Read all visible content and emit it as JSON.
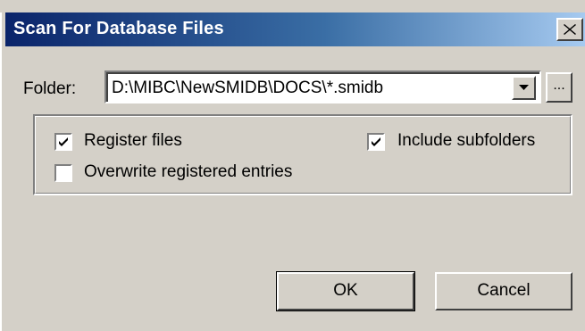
{
  "window": {
    "title": "Scan For Database Files",
    "close_icon": "close-icon"
  },
  "folder": {
    "label": "Folder:",
    "value": "D:\\MIBC\\NewSMIDB\\DOCS\\*.smidb",
    "browse_label": "..."
  },
  "options": {
    "register_files": {
      "label": "Register files",
      "checked": true
    },
    "include_subfolders": {
      "label": "Include subfolders",
      "checked": true
    },
    "overwrite_entries": {
      "label": "Overwrite registered entries",
      "checked": false
    }
  },
  "buttons": {
    "ok_label": "OK",
    "cancel_label": "Cancel"
  }
}
